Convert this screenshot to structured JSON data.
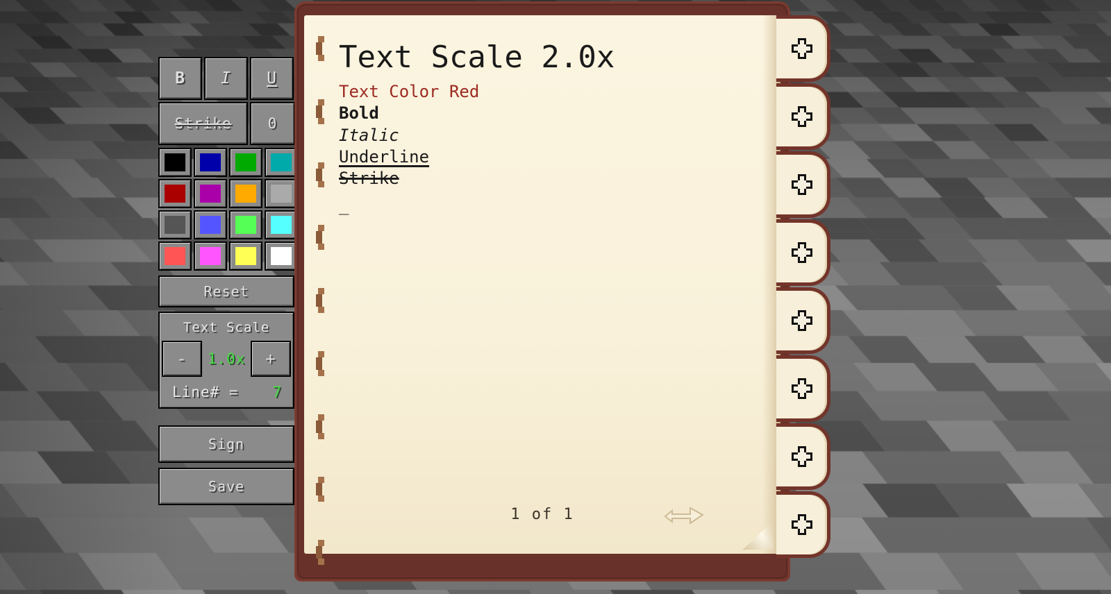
{
  "scene": {
    "background": "minecraft-stone-floor",
    "bg_colors": [
      "#6b6b6b",
      "#7a7a7a",
      "#8a8a8a",
      "#5e5e5e",
      "#969696",
      "#4f4f4f"
    ]
  },
  "toolbar": {
    "style_buttons": [
      {
        "name": "bold",
        "label": "B"
      },
      {
        "name": "italic",
        "label": "I"
      },
      {
        "name": "underline",
        "label": "U"
      }
    ],
    "strike_button": {
      "name": "strike",
      "label": "Strike"
    },
    "obfuscate_button": {
      "name": "obfuscate",
      "label": "0"
    },
    "colors": [
      {
        "name": "black",
        "hex": "#000000"
      },
      {
        "name": "dark-blue",
        "hex": "#0000AA"
      },
      {
        "name": "dark-green",
        "hex": "#00AA00"
      },
      {
        "name": "dark-aqua",
        "hex": "#00AAAA"
      },
      {
        "name": "dark-red",
        "hex": "#AA0000"
      },
      {
        "name": "dark-purple",
        "hex": "#AA00AA"
      },
      {
        "name": "gold",
        "hex": "#FFAA00"
      },
      {
        "name": "gray",
        "hex": "#AAAAAA"
      },
      {
        "name": "dark-gray",
        "hex": "#555555"
      },
      {
        "name": "blue",
        "hex": "#5555FF"
      },
      {
        "name": "green",
        "hex": "#55FF55"
      },
      {
        "name": "aqua",
        "hex": "#55FFFF"
      },
      {
        "name": "red",
        "hex": "#FF5555"
      },
      {
        "name": "light-purple",
        "hex": "#FF55FF"
      },
      {
        "name": "yellow",
        "hex": "#FFFF55"
      },
      {
        "name": "white",
        "hex": "#FFFFFF"
      }
    ],
    "reset_label": "Reset",
    "scale_panel": {
      "title": "Text Scale",
      "decrease_label": "-",
      "increase_label": "+",
      "value": "1.0x",
      "value_color": "#44DD44",
      "line_label": "Line# =",
      "line_value": "7",
      "line_value_color": "#44DD44"
    },
    "sign_label": "Sign",
    "save_label": "Save"
  },
  "book": {
    "cover_color": "#68322a",
    "page_color": "#faf3df",
    "lines": [
      {
        "text": "Text Scale 2.0x",
        "style": "title",
        "color": "#1a1a1a"
      },
      {
        "text": "Text Color Red",
        "style": "normal",
        "color": "#9C2A22"
      },
      {
        "text": "Bold",
        "style": "bold",
        "color": "#1a1a1a"
      },
      {
        "text": "Italic",
        "style": "italic",
        "color": "#1a1a1a"
      },
      {
        "text": "Underline",
        "style": "underline",
        "color": "#1a1a1a"
      },
      {
        "text": "Strike",
        "style": "strike",
        "color": "#1a1a1a"
      },
      {
        "text": "_",
        "style": "caret",
        "color": "#1a1a1a"
      }
    ],
    "footer": "1 of 1",
    "page_turn_icon": "page-turn-arrow-icon",
    "tabs": [
      {
        "icon": "plus-icon"
      },
      {
        "icon": "plus-icon"
      },
      {
        "icon": "plus-icon"
      },
      {
        "icon": "plus-icon"
      },
      {
        "icon": "plus-icon"
      },
      {
        "icon": "plus-icon"
      },
      {
        "icon": "plus-icon"
      },
      {
        "icon": "plus-icon"
      }
    ]
  }
}
